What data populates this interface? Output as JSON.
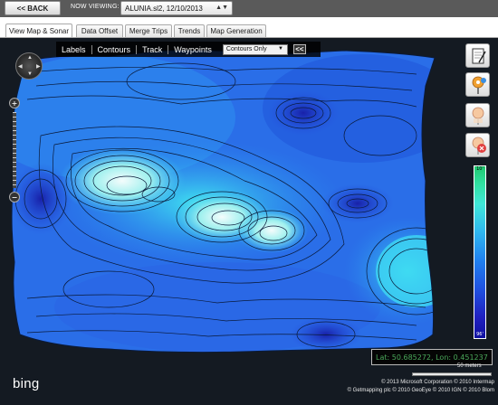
{
  "header": {
    "back_label": "<< BACK",
    "now_viewing_label": "NOW VIEWING:",
    "trip_selected": "ALUNIA.sl2, 12/10/2013"
  },
  "tabs": [
    {
      "label": "View Map & Sonar",
      "active": true
    },
    {
      "label": "Data Offset",
      "active": false
    },
    {
      "label": "Merge Trips",
      "active": false
    },
    {
      "label": "Trends",
      "active": false
    },
    {
      "label": "Map Generation",
      "active": false
    }
  ],
  "layers": {
    "labels": "Labels",
    "contours": "Contours",
    "track": "Track",
    "waypoints": "Waypoints",
    "contour_mode": "Contours Only",
    "collapse": "<<"
  },
  "map": {
    "colors": {
      "background": "#141a22",
      "deep": "#1a2ab0",
      "mid": "#2470e8",
      "shallow": "#38d8f0",
      "peak": "#e8f8f8",
      "contour": "#0a1a3a"
    }
  },
  "tools": [
    {
      "icon": "notepad-icon"
    },
    {
      "icon": "add-waypoint-icon"
    },
    {
      "icon": "waypoint-icon"
    },
    {
      "icon": "delete-waypoint-icon"
    }
  ],
  "scale": {
    "top": "10'",
    "bottom": "96'"
  },
  "readout": {
    "lat_label": "Lat:",
    "lat": "50.685272",
    "lon_label": "Lon:",
    "lon": "0.451237",
    "distance": "50 meters"
  },
  "copyright": {
    "line1": "© 2013 Microsoft Corporation   © 2010 Intermap",
    "line2": "© Getmapping plc   © 2010 GeoEye   © 2010 IGN   © 2010 Blom"
  },
  "logo": "bing"
}
